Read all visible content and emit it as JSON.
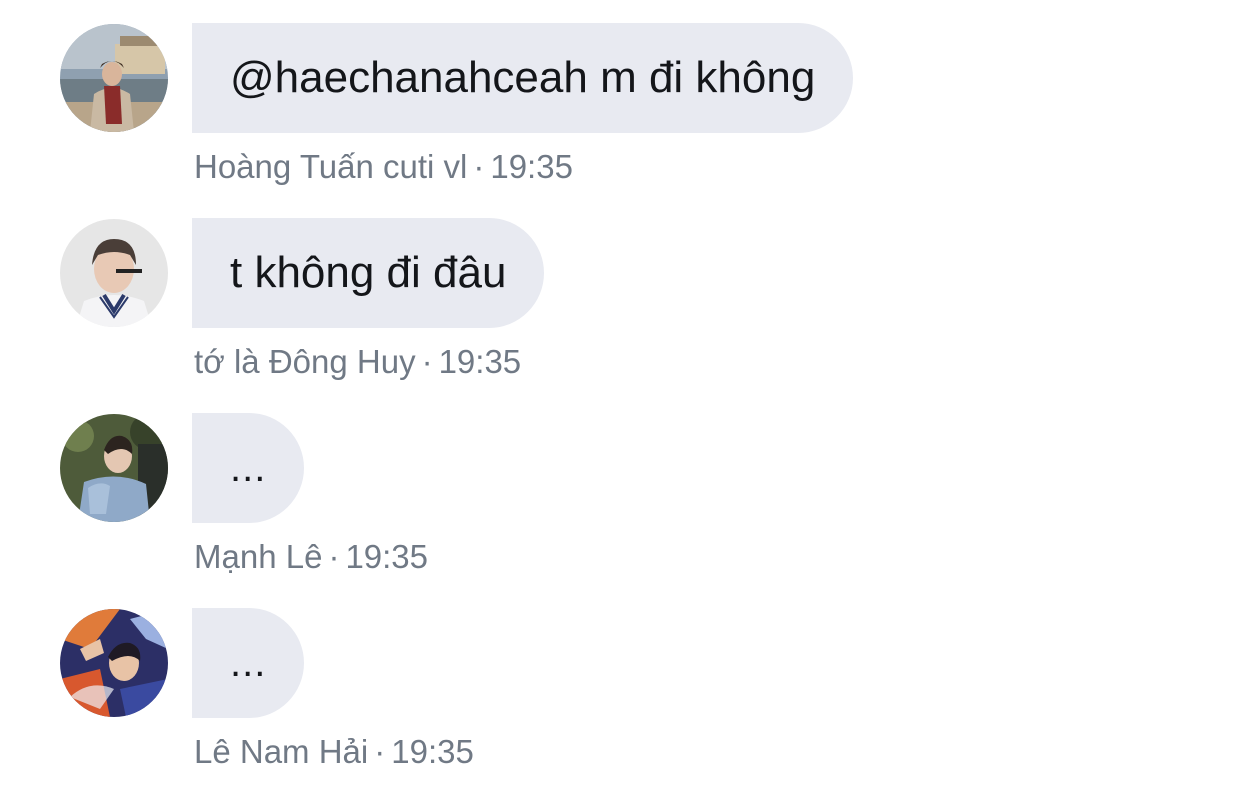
{
  "messages": [
    {
      "avatar_icon": "user-avatar-photo",
      "text": "@haechanahceah m đi không",
      "sender": "Hoàng Tuấn cuti vl",
      "time": "19:35"
    },
    {
      "avatar_icon": "user-avatar-photo",
      "text": "t không đi đâu",
      "sender": "tớ là Đông Huy",
      "time": "19:35"
    },
    {
      "avatar_icon": "user-avatar-photo",
      "text": "...",
      "sender": "Mạnh Lê",
      "time": "19:35"
    },
    {
      "avatar_icon": "user-avatar-photo",
      "text": "...",
      "sender": "Lê Nam Hải",
      "time": "19:35"
    }
  ],
  "separator": "·",
  "colors": {
    "bubble_bg": "#e8eaf1",
    "message_text": "#14161a",
    "meta_text": "#707985"
  }
}
